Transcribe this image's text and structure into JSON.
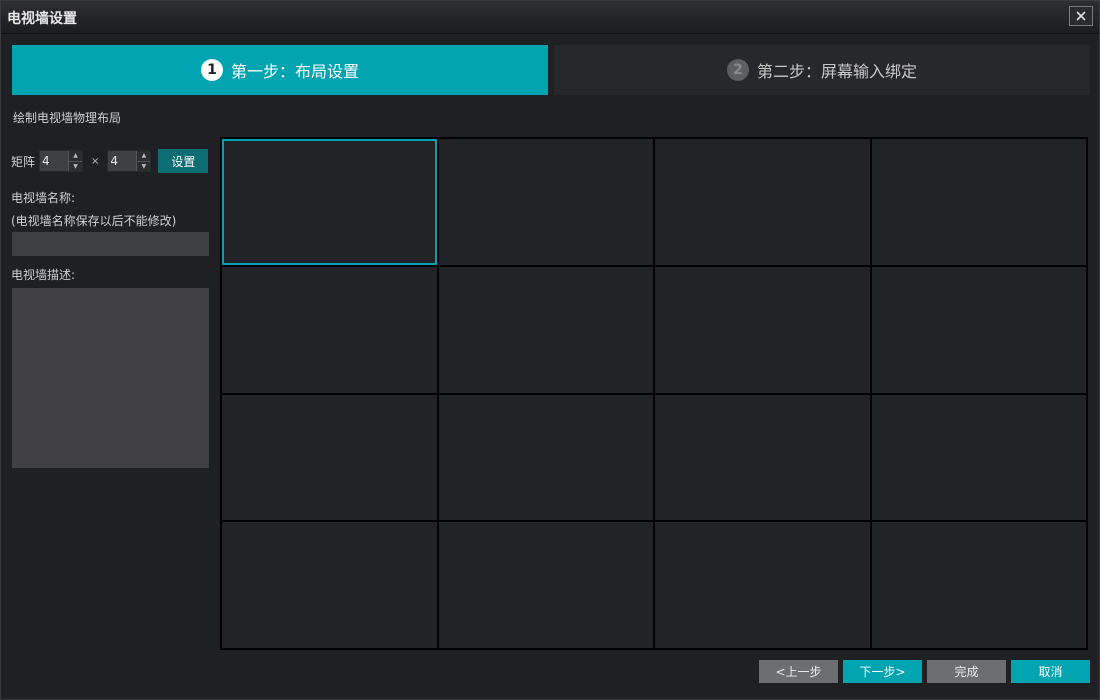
{
  "window": {
    "title": "电视墙设置"
  },
  "steps": [
    {
      "num": "1",
      "label": "第一步：布局设置"
    },
    {
      "num": "2",
      "label": "第二步：屏幕输入绑定"
    }
  ],
  "layout": {
    "section_title": "绘制电视墙物理布局",
    "matrix_label": "矩阵",
    "rows": "4",
    "times": "×",
    "cols": "4",
    "set_button": "设置",
    "name_label": "电视墙名称:",
    "name_hint": "(电视墙名称保存以后不能修改)",
    "name_value": "",
    "desc_label": "电视墙描述:",
    "desc_value": ""
  },
  "grid": {
    "rows": 4,
    "cols": 4,
    "selected_cell": 0
  },
  "footer": {
    "prev": "<上一步",
    "next": "下一步>",
    "done": "完成",
    "cancel": "取消"
  },
  "colors": {
    "accent": "#00a3b0",
    "background": "#1f2024",
    "cell": "#222327"
  }
}
